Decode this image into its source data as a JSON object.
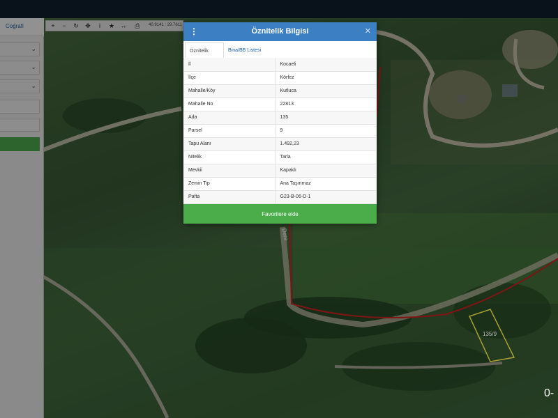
{
  "sidebar": {
    "tab_label": "Coğrafi"
  },
  "toolbar": {
    "icons": [
      "plus-icon",
      "minus-icon",
      "refresh-icon",
      "locate-icon",
      "info-icon",
      "star-icon",
      "measure-icon",
      "print-icon"
    ],
    "coordinates": "40.9141 : 29.7611"
  },
  "modal": {
    "title": "Öznitelik Bilgisi",
    "tabs": [
      "Öznitelik Bilgisi",
      "Bina/BB Listesi"
    ],
    "rows": [
      {
        "key": "İl",
        "value": "Kocaeli"
      },
      {
        "key": "İlçe",
        "value": "Körfez"
      },
      {
        "key": "Mahalle/Köy",
        "value": "Kutluca"
      },
      {
        "key": "Mahalle No",
        "value": "22813"
      },
      {
        "key": "Ada",
        "value": "135"
      },
      {
        "key": "Parsel",
        "value": "9"
      },
      {
        "key": "Tapu Alanı",
        "value": "1.492,23"
      },
      {
        "key": "Nitelik",
        "value": "Tarla"
      },
      {
        "key": "Mevkii",
        "value": "Kapaklı"
      },
      {
        "key": "Zemin Tip",
        "value": "Ana Taşınmaz"
      },
      {
        "key": "Pafta",
        "value": "G23-B-06-D-1"
      }
    ],
    "favorite_button": "Favorilere ekle"
  },
  "map": {
    "parcel_label": "135/9",
    "road_label": "Dere",
    "corner_text": "0-"
  }
}
